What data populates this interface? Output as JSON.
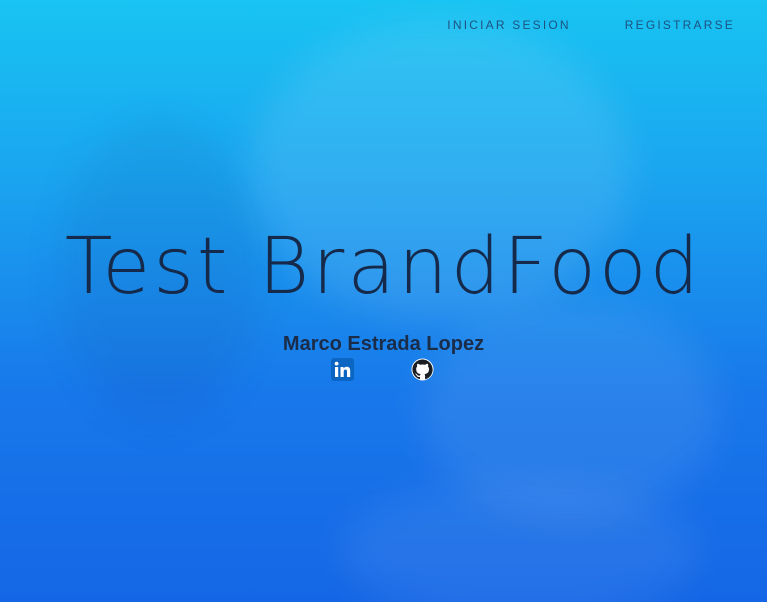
{
  "nav": {
    "login_label": "INICIAR SESION",
    "register_label": "REGISTRARSE"
  },
  "hero": {
    "title": "Test BrandFood",
    "author": "Marco Estrada Lopez"
  },
  "socials": {
    "linkedin_icon": "linkedin-icon",
    "github_icon": "github-icon"
  },
  "colors": {
    "gradient_top": "#18c4f2",
    "gradient_bottom": "#1566e6",
    "text_dark": "#152a4a"
  }
}
